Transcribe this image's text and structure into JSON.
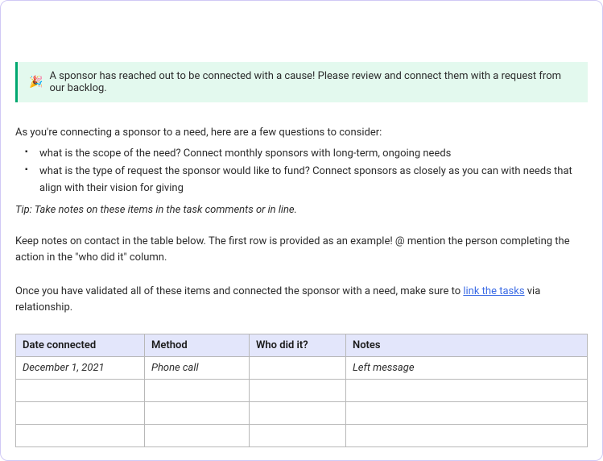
{
  "callout": {
    "emoji": "🎉",
    "text": "A sponsor has reached out to be connected with a cause! Please review and connect them with a request from our backlog."
  },
  "intro": "As you're connecting a sponsor to a need, here are a few questions to consider:",
  "questions": [
    "what is the scope of the need? Connect monthly sponsors with long-term, ongoing needs",
    "what is the type of request the sponsor would like to fund? Connect sponsors as closely as you can with needs that align with their vision for giving"
  ],
  "tip": "Tip: Take notes on these items in the task comments or in line.",
  "notes_para": "Keep notes on contact in the table below. The first row is provided as an example! @ mention the person completing the action in the \"who did it\" column.",
  "validate_para": {
    "before": "Once you have validated all of these items and connected the sponsor with a need, make sure to ",
    "link": "link the tasks",
    "after": " via relationship."
  },
  "table": {
    "headers": [
      "Date connected",
      "Method",
      "Who did it?",
      "Notes"
    ],
    "rows": [
      {
        "date": "December 1, 2021",
        "method": "Phone call",
        "who": "",
        "notes": "Left message",
        "example": true
      },
      {
        "date": "",
        "method": "",
        "who": "",
        "notes": "",
        "example": false
      },
      {
        "date": "",
        "method": "",
        "who": "",
        "notes": "",
        "example": false
      },
      {
        "date": "",
        "method": "",
        "who": "",
        "notes": "",
        "example": false
      }
    ]
  }
}
